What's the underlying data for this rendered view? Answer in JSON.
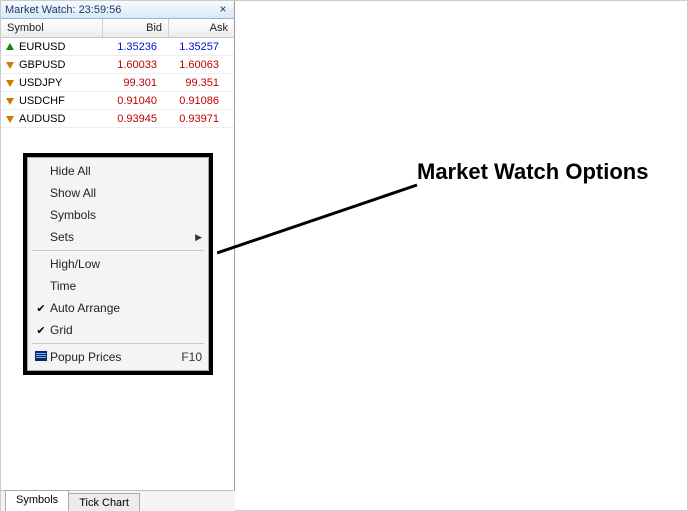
{
  "panel": {
    "title_prefix": "Market Watch: ",
    "time": "23:59:56",
    "close_glyph": "×"
  },
  "headers": {
    "symbol": "Symbol",
    "bid": "Bid",
    "ask": "Ask"
  },
  "rows": [
    {
      "symbol": "EURUSD",
      "bid": "1.35236",
      "ask": "1.35257",
      "dir": "up"
    },
    {
      "symbol": "GBPUSD",
      "bid": "1.60033",
      "ask": "1.60063",
      "dir": "down"
    },
    {
      "symbol": "USDJPY",
      "bid": "99.301",
      "ask": "99.351",
      "dir": "down"
    },
    {
      "symbol": "USDCHF",
      "bid": "0.91040",
      "ask": "0.91086",
      "dir": "down"
    },
    {
      "symbol": "AUDUSD",
      "bid": "0.93945",
      "ask": "0.93971",
      "dir": "down"
    }
  ],
  "context_menu": {
    "items": [
      {
        "label": "Hide All"
      },
      {
        "label": "Show All"
      },
      {
        "label": "Symbols"
      },
      {
        "label": "Sets",
        "submenu": true
      },
      {
        "sep": true
      },
      {
        "label": "High/Low"
      },
      {
        "label": "Time"
      },
      {
        "label": "Auto Arrange",
        "checked": true
      },
      {
        "label": "Grid",
        "checked": true
      },
      {
        "sep": true
      },
      {
        "label": "Popup Prices",
        "shortcut": "F10",
        "icon": "popup"
      }
    ]
  },
  "tabs": {
    "symbols": "Symbols",
    "tick_chart": "Tick Chart"
  },
  "annotation": {
    "label": "Market Watch Options"
  },
  "glyphs": {
    "check": "✔",
    "submenu": "▶"
  }
}
